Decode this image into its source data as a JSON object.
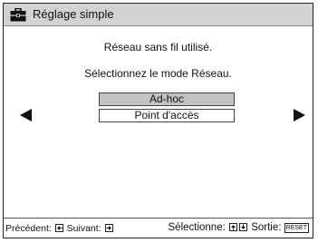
{
  "header": {
    "title": "Réglage simple",
    "icon": "toolbox-icon"
  },
  "messages": {
    "line1": "Réseau sans fil utilisé.",
    "line2": "Sélectionnez le mode Réseau."
  },
  "options": [
    {
      "label": "Ad-hoc",
      "selected": true
    },
    {
      "label": "Point d'accès",
      "selected": false
    }
  ],
  "footer": {
    "prev_label": "Précédent:",
    "next_label": "Suivant:",
    "select_label": "Sélectionne:",
    "exit_label": "Sortie:",
    "reset_key": "RESET"
  },
  "colors": {
    "titlebar": "#d2d2d2",
    "selected": "#c2c2c2"
  }
}
